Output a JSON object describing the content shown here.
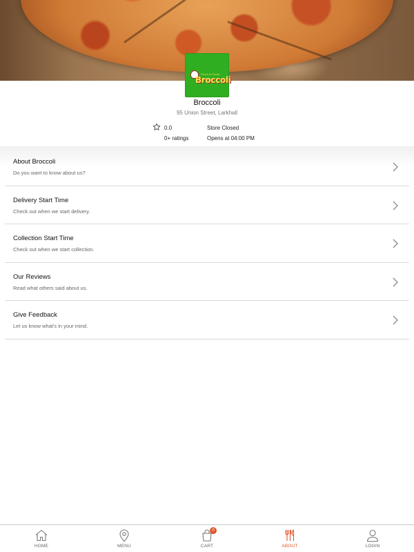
{
  "store": {
    "name": "Broccoli",
    "address": "95 Union Street, Larkhall",
    "rating": "0.0",
    "rating_count": "0+ ratings",
    "status": "Store Closed",
    "opens": "Opens at 04:00 PM",
    "logo_text": "Broccoli",
    "logo_small_text": "Pizza & Pasta"
  },
  "menu_items": [
    {
      "title": "About Broccoli",
      "subtitle": "Do you want to know about us?"
    },
    {
      "title": "Delivery Start Time",
      "subtitle": "Check out when we start delivery."
    },
    {
      "title": "Collection Start Time",
      "subtitle": "Check out when we start collection."
    },
    {
      "title": "Our Reviews",
      "subtitle": "Read what others said about us."
    },
    {
      "title": "Give Feedback",
      "subtitle": "Let us know what's in your mind."
    }
  ],
  "nav": [
    {
      "label": "HOME",
      "icon": "home-icon"
    },
    {
      "label": "MENU",
      "icon": "location-pin-icon"
    },
    {
      "label": "CART",
      "icon": "cart-bag-icon",
      "badge": "0"
    },
    {
      "label": "ABOUT",
      "icon": "fork-knife-icon",
      "active": true
    },
    {
      "label": "LOGIN",
      "icon": "user-icon"
    }
  ],
  "colors": {
    "accent": "#e0542b",
    "logo_green": "#2fae22",
    "logo_yellow": "#ffe04d",
    "divider": "#d9d9d9"
  }
}
